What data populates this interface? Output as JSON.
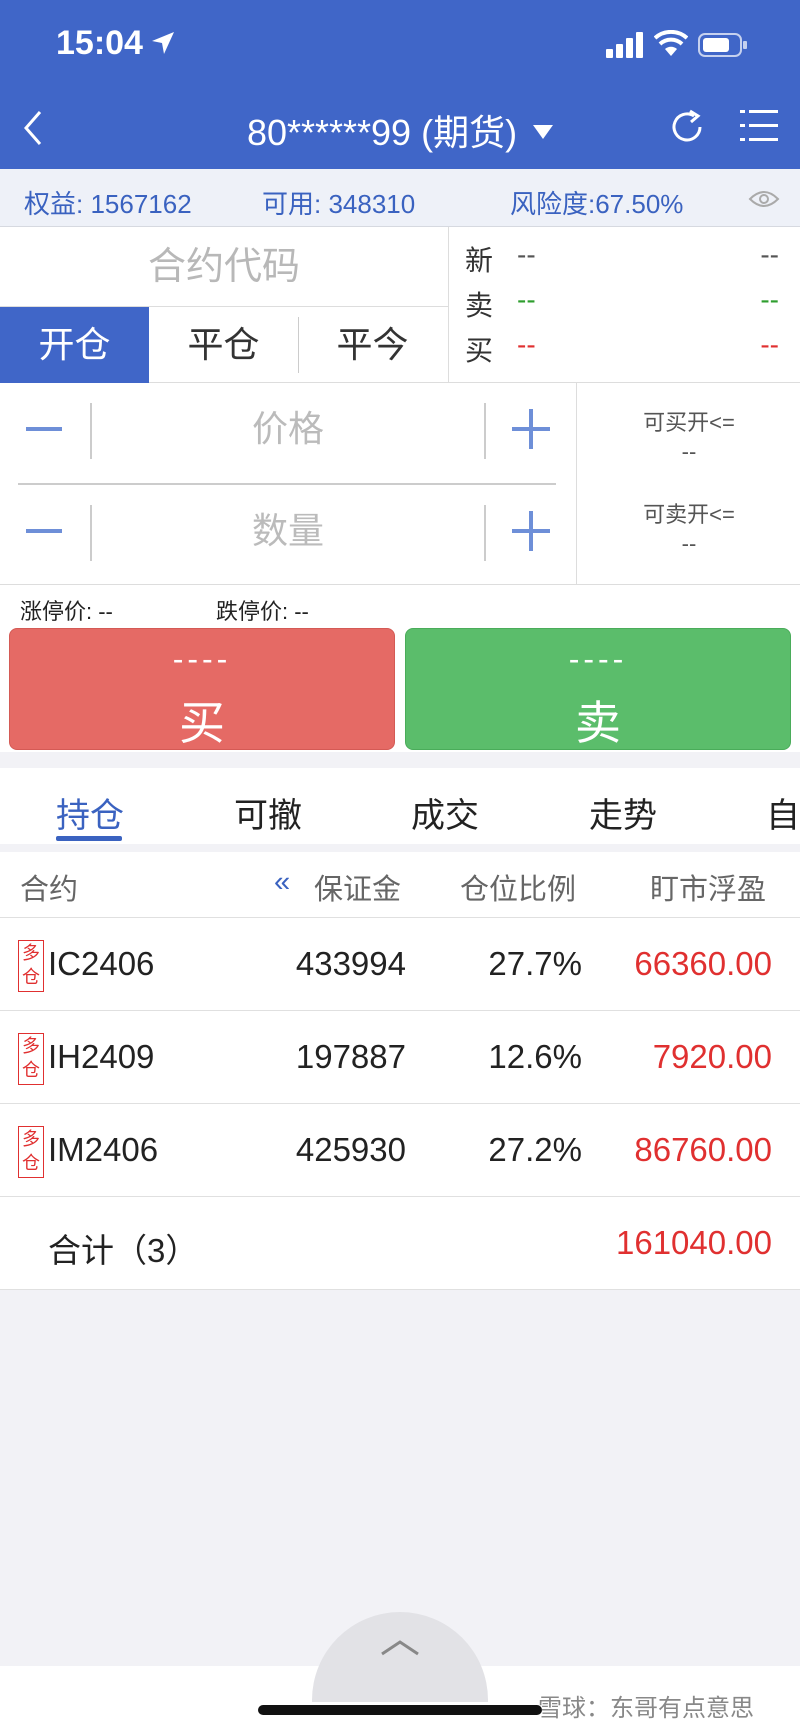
{
  "status_bar": {
    "time": "15:04"
  },
  "header": {
    "account": "80******99 (期货)"
  },
  "info": {
    "equity": "权益: 1567162",
    "available": "可用: 348310",
    "risk": "风险度:67.50%"
  },
  "order": {
    "contract_placeholder": "合约代码",
    "modes": [
      "开仓",
      "平仓",
      "平今"
    ],
    "quote": [
      {
        "label": "新",
        "left": "--",
        "right": "--"
      },
      {
        "label": "卖",
        "left": "--",
        "right": "--"
      },
      {
        "label": "买",
        "left": "--",
        "right": "--"
      }
    ],
    "price_placeholder": "价格",
    "qty_placeholder": "数量",
    "can_buy_label": "可买开<=",
    "can_buy_value": "--",
    "can_sell_label": "可卖开<=",
    "can_sell_value": "--",
    "limit_up": "涨停价: --",
    "limit_down": "跌停价: --",
    "buy": {
      "dash": "----",
      "label": "买"
    },
    "sell": {
      "dash": "----",
      "label": "卖"
    }
  },
  "tabs": [
    "持仓",
    "可撤",
    "成交",
    "走势",
    "自"
  ],
  "positions": {
    "headers": {
      "contract": "合约",
      "collapse": "«",
      "margin": "保证金",
      "ratio": "仓位比例",
      "pnl": "盯市浮盈"
    },
    "rows": [
      {
        "tag": "多仓",
        "tag_top": "多",
        "tag_bottom": "仓",
        "contract": "IC2406",
        "margin": "433994",
        "ratio": "27.7%",
        "pnl": "66360.00"
      },
      {
        "tag": "多仓",
        "tag_top": "多",
        "tag_bottom": "仓",
        "contract": "IH2409",
        "margin": "197887",
        "ratio": "12.6%",
        "pnl": "7920.00"
      },
      {
        "tag": "多仓",
        "tag_top": "多",
        "tag_bottom": "仓",
        "contract": "IM2406",
        "margin": "425930",
        "ratio": "27.2%",
        "pnl": "86760.00"
      }
    ],
    "total_label": "合计（3）",
    "total_value": "161040.00"
  },
  "watermark": "雪球：东哥有点意思",
  "colors": {
    "header": "#4066c8",
    "buy": "#e56a65",
    "sell": "#5bbd6b",
    "profit": "#e03030"
  }
}
